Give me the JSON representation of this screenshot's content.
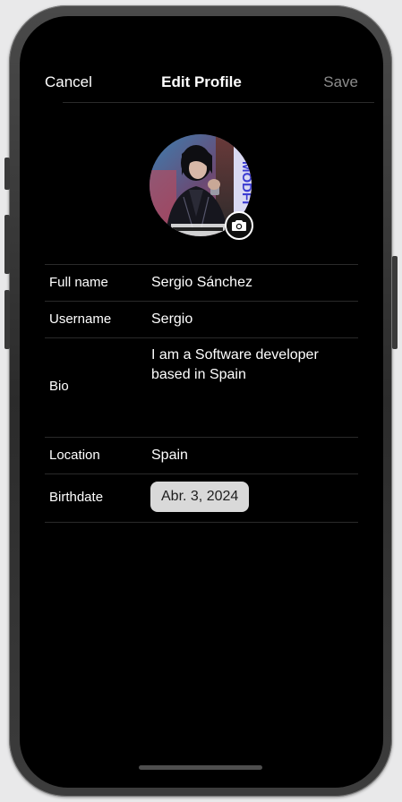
{
  "nav": {
    "cancel_label": "Cancel",
    "title": "Edit Profile",
    "save_label": "Save"
  },
  "avatar": {
    "overlay_text": "MODFI",
    "camera_icon": "camera-icon"
  },
  "form": {
    "fields": [
      {
        "label": "Full name",
        "value": "Sergio Sánchez"
      },
      {
        "label": "Username",
        "value": "Sergio"
      },
      {
        "label": "Bio",
        "value": "I am a Software developer based in Spain"
      },
      {
        "label": "Location",
        "value": "Spain"
      },
      {
        "label": "Birthdate",
        "value": "Abr. 3, 2024"
      }
    ]
  },
  "colors": {
    "background": "#000000",
    "text": "#ffffff",
    "save_disabled": "#8c8c8c",
    "divider": "#2a2a2a",
    "date_pill": "#d9d9d9"
  }
}
